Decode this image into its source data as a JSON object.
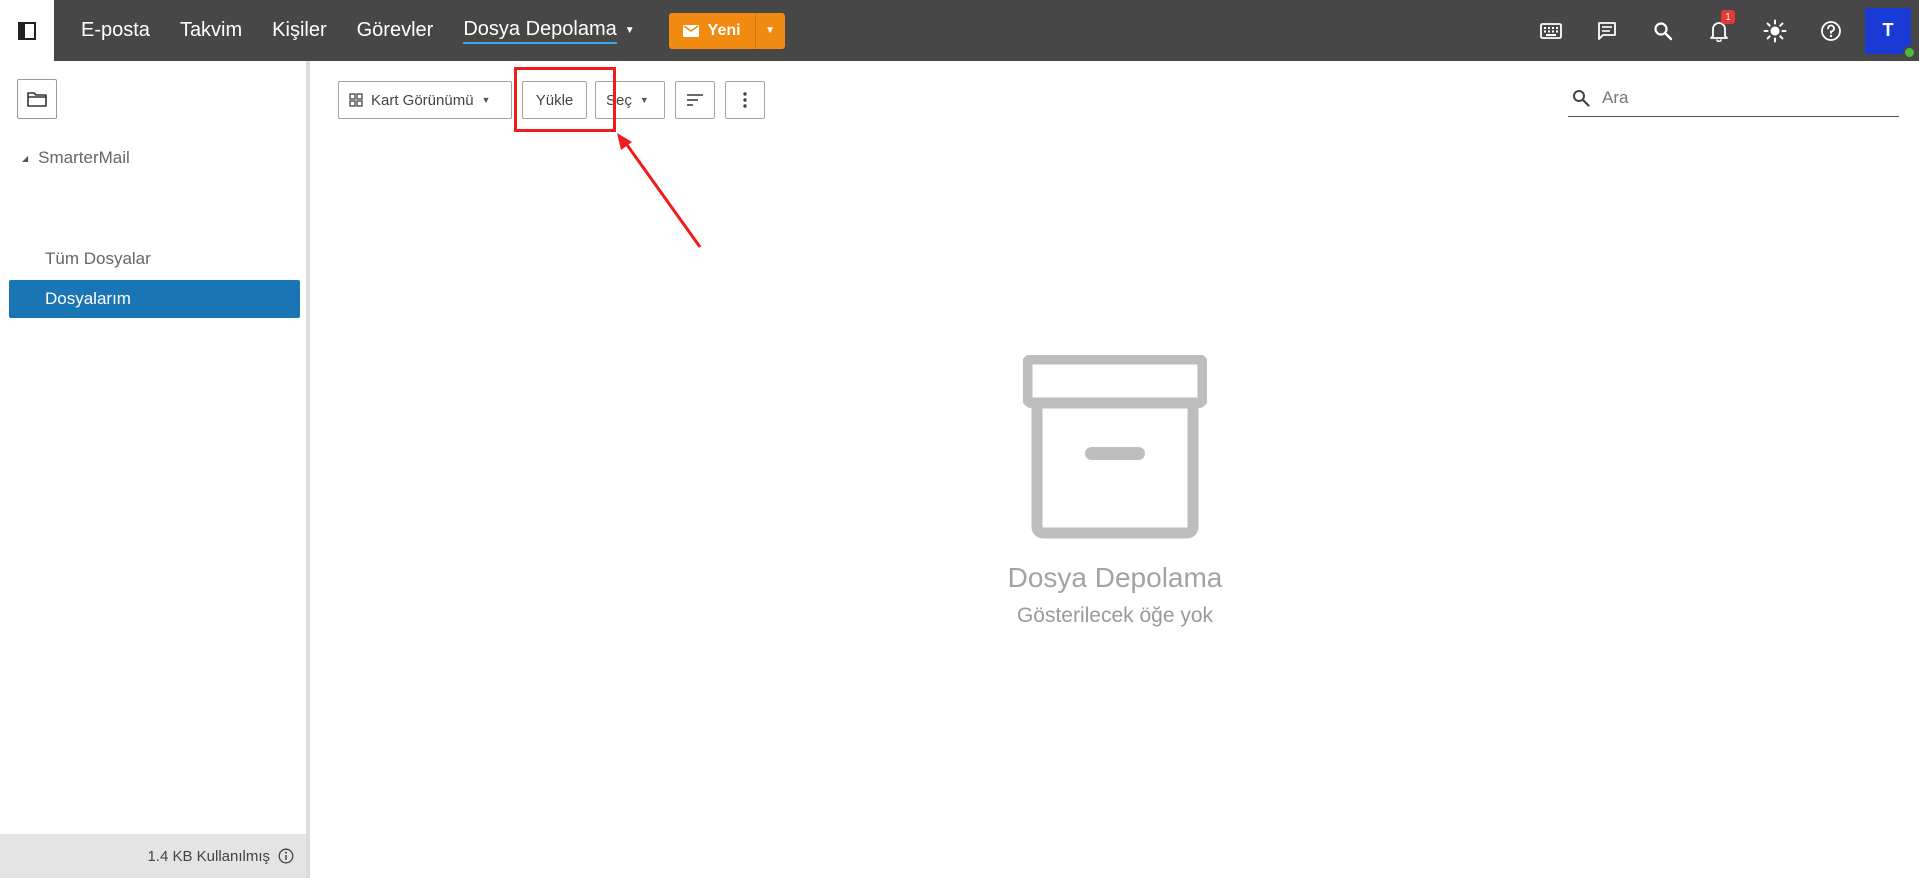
{
  "topbar": {
    "nav": [
      {
        "label": "E-posta"
      },
      {
        "label": "Takvim"
      },
      {
        "label": "Kişiler"
      },
      {
        "label": "Görevler"
      },
      {
        "label": "Dosya Depolama"
      }
    ],
    "new_button_label": "Yeni",
    "notification_count": "1",
    "avatar_initial": "T",
    "icons": [
      "keyboard-icon",
      "chat-icon",
      "search-icon",
      "bell-icon",
      "brightness-icon",
      "help-icon"
    ]
  },
  "sidebar": {
    "tree_root": "SmarterMail",
    "items": [
      {
        "label": "Tüm Dosyalar"
      },
      {
        "label": "Dosyalarım"
      }
    ],
    "footer_text": "1.4 KB Kullanılmış"
  },
  "toolbar": {
    "view_label": "Kart Görünümü",
    "upload_label": "Yükle",
    "select_label": "Seç"
  },
  "search": {
    "placeholder": "Ara"
  },
  "empty_state": {
    "title": "Dosya Depolama",
    "subtitle": "Gösterilecek öğe yok"
  },
  "colors": {
    "topbar": "#474747",
    "accent_orange": "#f08a10",
    "selected_blue": "#1a75b5",
    "annotation_red": "#ee1c1c"
  }
}
